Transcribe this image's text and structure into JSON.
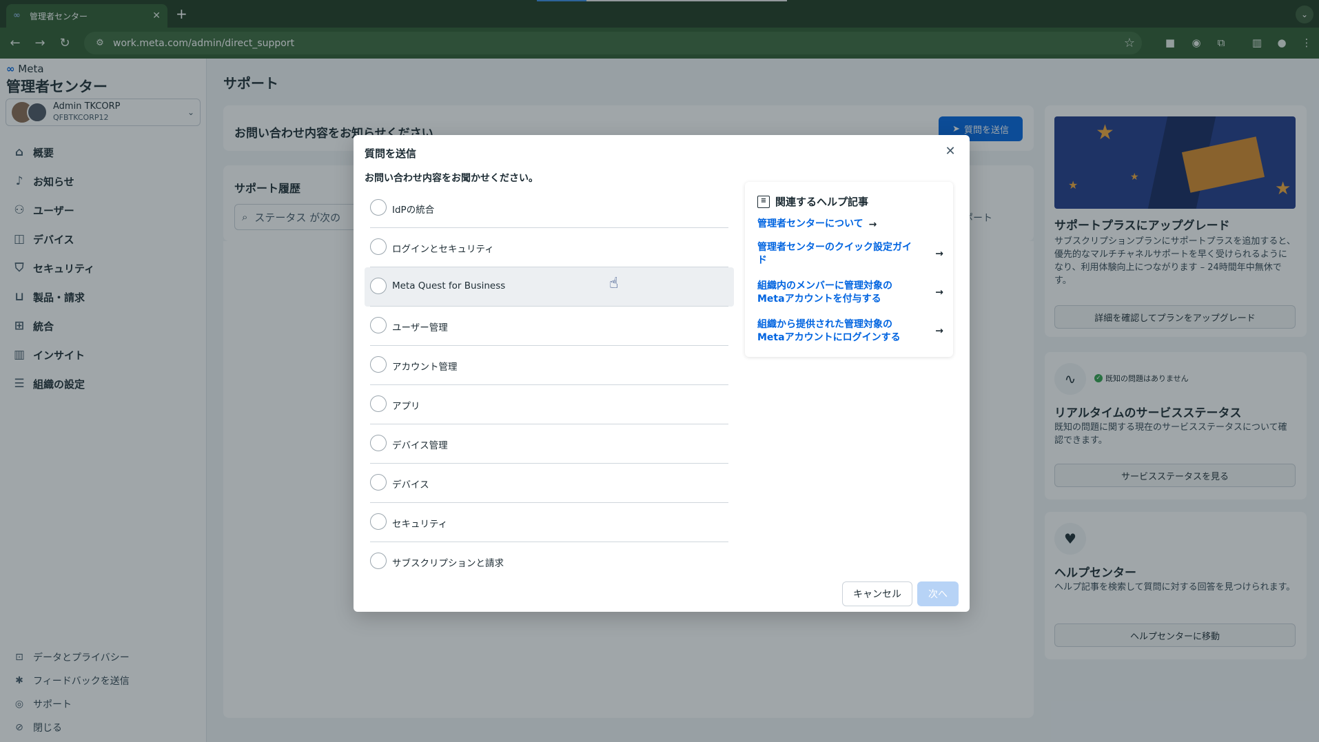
{
  "browser": {
    "tab_title": "管理者センター",
    "tab_close": "✕",
    "new_tab": "+",
    "url": "work.meta.com/admin/direct_support"
  },
  "sidebar": {
    "brand": "Meta",
    "title": "管理者センター",
    "account": {
      "name": "Admin TKCORP",
      "id": "QFBTKCORP12"
    },
    "items": [
      {
        "label": "概要",
        "icon": "home-icon"
      },
      {
        "label": "お知らせ",
        "icon": "bell-icon"
      },
      {
        "label": "ユーザー",
        "icon": "users-icon"
      },
      {
        "label": "デバイス",
        "icon": "vr-headset-icon"
      },
      {
        "label": "セキュリティ",
        "icon": "shield-icon"
      },
      {
        "label": "製品・請求",
        "icon": "cart-icon"
      },
      {
        "label": "統合",
        "icon": "integrations-icon"
      },
      {
        "label": "インサイト",
        "icon": "bar-chart-icon"
      },
      {
        "label": "組織の設定",
        "icon": "settings-icon"
      }
    ],
    "footer": [
      {
        "label": "データとプライバシー",
        "icon": "lock-icon"
      },
      {
        "label": "フィードバックを送信",
        "icon": "feedback-icon"
      },
      {
        "label": "サポート",
        "icon": "globe-icon"
      },
      {
        "label": "閉じる",
        "icon": "close-circle-icon"
      }
    ]
  },
  "main": {
    "page_title": "サポート",
    "ask_card": {
      "heading": "お問い合わせ内容をお知らせください",
      "button": "質問を送信"
    },
    "history": {
      "heading": "サポート履歴",
      "search_placeholder": "ステータス が次の",
      "export": "エクスポート"
    }
  },
  "right": {
    "upgrade": {
      "title": "サポートプラスにアップグレード",
      "desc": "サブスクリプションプランにサポートプラスを追加すると、優先的なマルチチャネルサポートを早く受けられるようになり、利用体験向上につながります – 24時間年中無休です。",
      "button": "詳細を確認してプランをアップグレード"
    },
    "status": {
      "pill": "既知の問題はありません",
      "title": "リアルタイムのサービスステータス",
      "desc": "既知の問題に関する現在のサービスステータスについて確認できます。",
      "button": "サービスステータスを見る"
    },
    "help_center": {
      "title": "ヘルプセンター",
      "desc": "ヘルプ記事を検索して質問に対する回答を見つけられます。",
      "button": "ヘルプセンターに移動"
    }
  },
  "modal": {
    "title": "質問を送信",
    "prompt": "お問い合わせ内容をお聞かせください。",
    "options": [
      "IdPの統合",
      "ログインとセキュリティ",
      "Meta Quest for Business",
      "ユーザー管理",
      "アカウント管理",
      "アプリ",
      "デバイス管理",
      "デバイス",
      "セキュリティ",
      "サブスクリプションと請求"
    ],
    "help": {
      "heading": "関連するヘルプ記事",
      "links": [
        "管理者センターについて",
        "管理者センターのクイック設定ガイド",
        "組織内のメンバーに管理対象のMetaアカウントを付与する",
        "組織から提供された管理対象のMetaアカウントにログインする"
      ]
    },
    "cancel": "キャンセル",
    "next": "次へ"
  },
  "colors": {
    "accent": "#0064e0",
    "chrome": "#2e5b30",
    "success": "#31a24c"
  }
}
